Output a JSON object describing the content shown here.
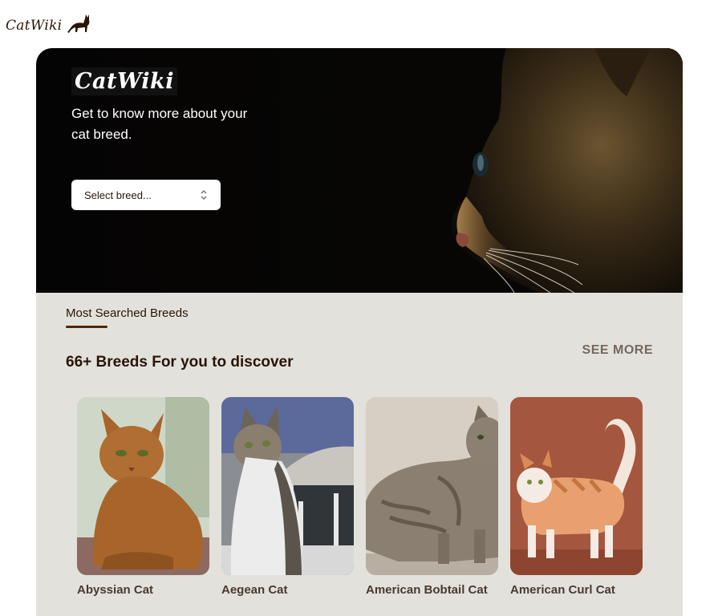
{
  "header": {
    "logo_text": "CatWiki",
    "logo_icon": "cat-silhouette-icon"
  },
  "hero": {
    "brand": "CatWiki",
    "tagline": "Get to know more about your cat breed.",
    "select_placeholder": "Select breed...",
    "select_icon": "chevron-up-down-icon"
  },
  "section": {
    "label": "Most Searched Breeds",
    "heading": "66+ Breeds For you to discover",
    "see_more": "SEE MORE",
    "breeds": [
      {
        "name": "Abyssian Cat"
      },
      {
        "name": "Aegean Cat"
      },
      {
        "name": "American Bobtail Cat"
      },
      {
        "name": "American Curl Cat"
      }
    ]
  },
  "colors": {
    "brand_dark": "#291507",
    "section_bg": "#e3e1dc",
    "hero_bg": "#050404"
  }
}
